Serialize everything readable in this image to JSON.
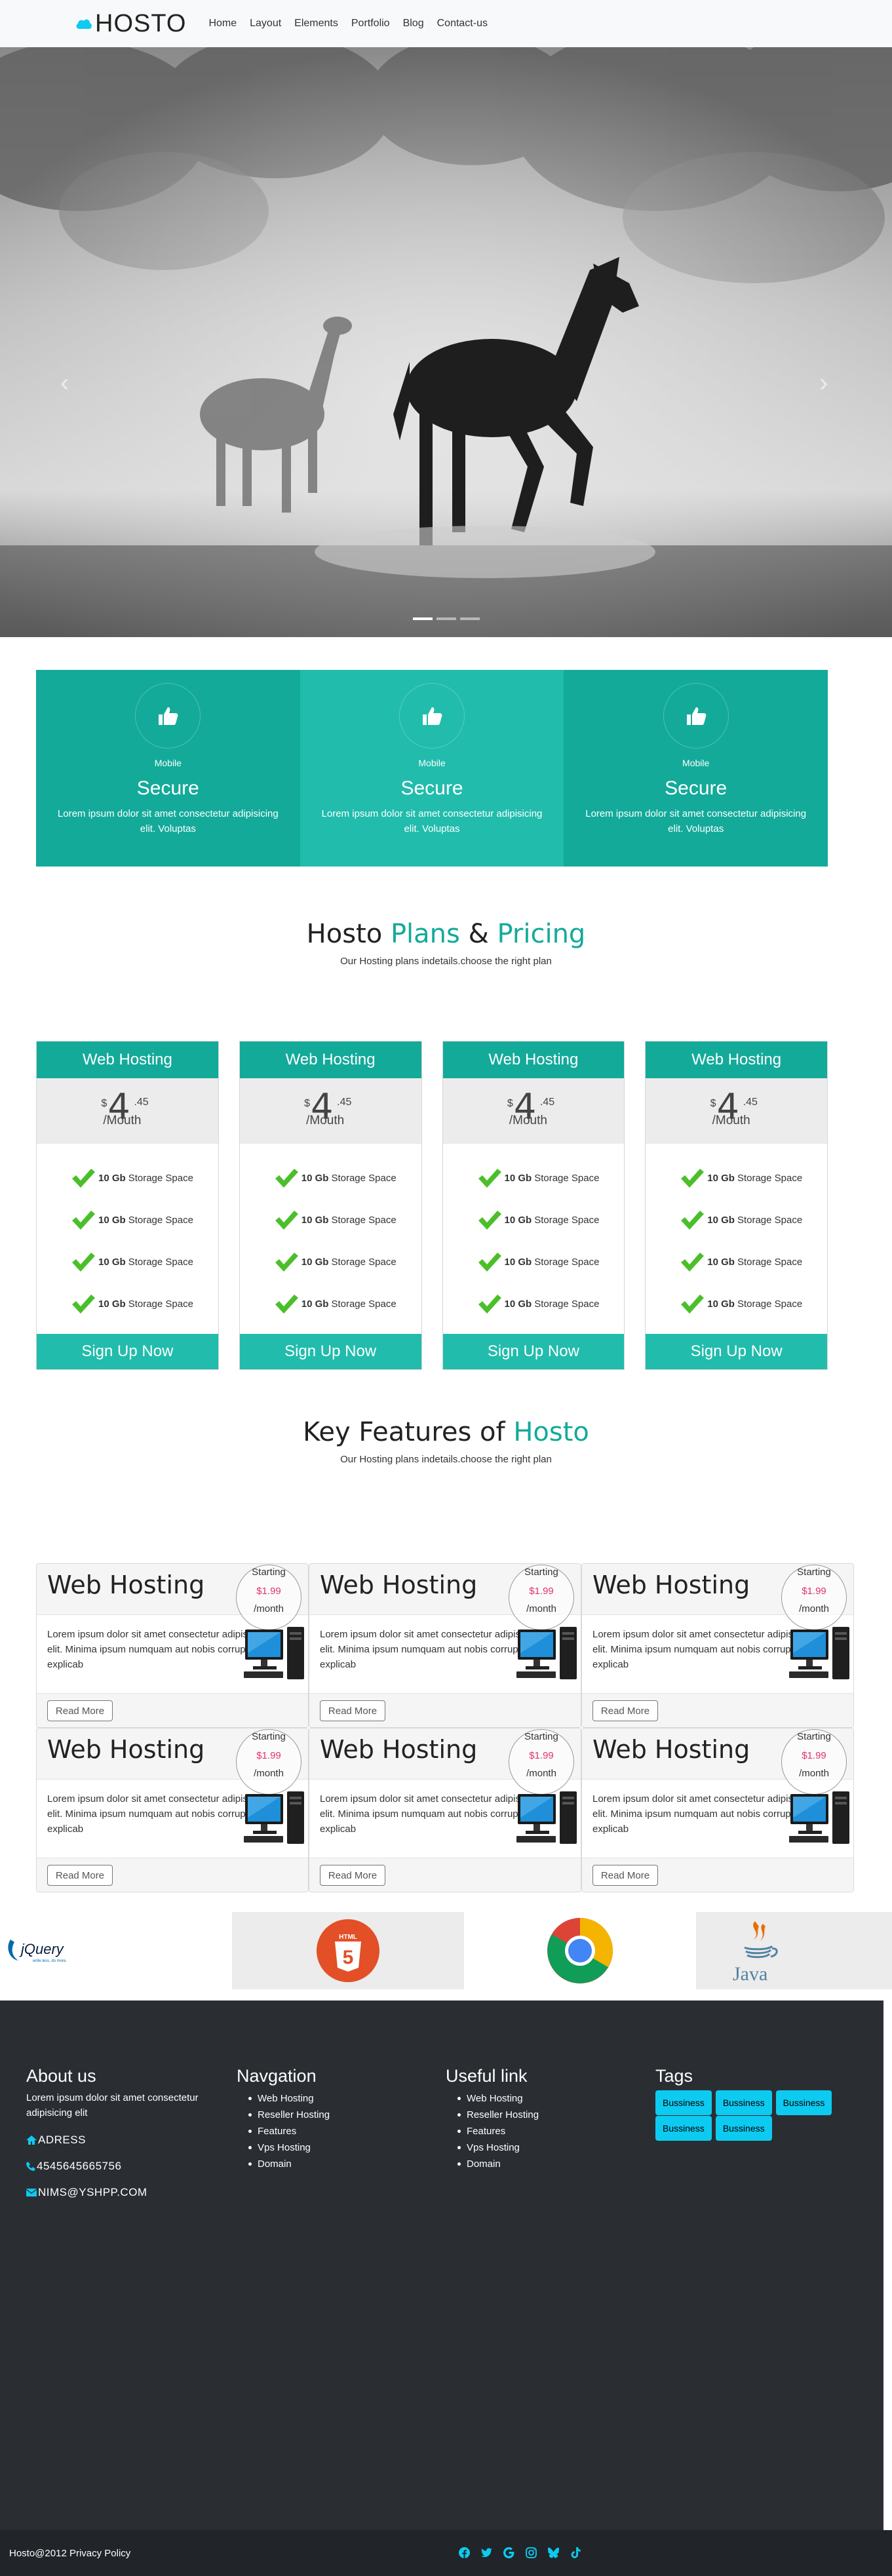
{
  "navbar": {
    "brand": "HOSTO",
    "links": [
      "Home",
      "Layout",
      "Elements",
      "Portfolio",
      "Blog",
      "Contact-us"
    ]
  },
  "carousel": {
    "slide_count": 3,
    "active_slide": 1
  },
  "features": [
    {
      "category": "Mobile",
      "title": "Secure",
      "desc_line1": "Lorem ipsum dolor sit amet consectetur adipisicing",
      "desc_line2": "elit. Voluptas"
    },
    {
      "category": "Mobile",
      "title": "Secure",
      "desc_line1": "Lorem ipsum dolor sit amet consectetur adipisicing",
      "desc_line2": "elit. Voluptas"
    },
    {
      "category": "Mobile",
      "title": "Secure",
      "desc_line1": "Lorem ipsum dolor sit amet consectetur adipisicing",
      "desc_line2": "elit. Voluptas"
    }
  ],
  "plans_section": {
    "title_a": "Hosto ",
    "title_b": "Plans",
    "title_c": " & ",
    "title_d": "Pricing",
    "subtitle": "Our Hosting plans indetails.choose the right plan"
  },
  "plans": [
    {
      "name": "Web Hosting",
      "currency": "$",
      "amount": "4",
      "decimal": ".45",
      "period": "/Mouth",
      "features": [
        {
          "qty": "10 Gb",
          "label": "Storage Space"
        },
        {
          "qty": "10 Gb",
          "label": "Storage Space"
        },
        {
          "qty": "10 Gb",
          "label": "Storage Space"
        },
        {
          "qty": "10 Gb",
          "label": "Storage Space"
        }
      ],
      "cta": "Sign Up Now"
    },
    {
      "name": "Web Hosting",
      "currency": "$",
      "amount": "4",
      "decimal": ".45",
      "period": "/Mouth",
      "features": [
        {
          "qty": "10 Gb",
          "label": "Storage Space"
        },
        {
          "qty": "10 Gb",
          "label": "Storage Space"
        },
        {
          "qty": "10 Gb",
          "label": "Storage Space"
        },
        {
          "qty": "10 Gb",
          "label": "Storage Space"
        }
      ],
      "cta": "Sign Up Now"
    },
    {
      "name": "Web Hosting",
      "currency": "$",
      "amount": "4",
      "decimal": ".45",
      "period": "/Mouth",
      "features": [
        {
          "qty": "10 Gb",
          "label": "Storage Space"
        },
        {
          "qty": "10 Gb",
          "label": "Storage Space"
        },
        {
          "qty": "10 Gb",
          "label": "Storage Space"
        },
        {
          "qty": "10 Gb",
          "label": "Storage Space"
        }
      ],
      "cta": "Sign Up Now"
    },
    {
      "name": "Web Hosting",
      "currency": "$",
      "amount": "4",
      "decimal": ".45",
      "period": "/Mouth",
      "features": [
        {
          "qty": "10 Gb",
          "label": "Storage Space"
        },
        {
          "qty": "10 Gb",
          "label": "Storage Space"
        },
        {
          "qty": "10 Gb",
          "label": "Storage Space"
        },
        {
          "qty": "10 Gb",
          "label": "Storage Space"
        }
      ],
      "cta": "Sign Up Now"
    }
  ],
  "features_section": {
    "title_a": "Key Features of ",
    "title_b": "Hosto",
    "subtitle": "Our Hosting plans indetails.choose the right plan"
  },
  "key_cards": [
    {
      "title": "Web Hosting",
      "badge_top": "Starting",
      "badge_price": "$1.99",
      "badge_per": "/month",
      "text_line1": "Lorem ipsum dolor sit amet consectetur adipisicing",
      "text_line2": "elit. Minima ipsum numquam aut nobis corrupti",
      "text_line3": "explicab",
      "button": "Read More"
    },
    {
      "title": "Web Hosting",
      "badge_top": "Starting",
      "badge_price": "$1.99",
      "badge_per": "/month",
      "text_line1": "Lorem ipsum dolor sit amet consectetur adipisicing",
      "text_line2": "elit. Minima ipsum numquam aut nobis corrupti",
      "text_line3": "explicab",
      "button": "Read More"
    },
    {
      "title": "Web Hosting",
      "badge_top": "Starting",
      "badge_price": "$1.99",
      "badge_per": "/month",
      "text_line1": "Lorem ipsum dolor sit amet consectetur adipisicing",
      "text_line2": "elit. Minima ipsum numquam aut nobis corrupti",
      "text_line3": "explicab",
      "button": "Read More"
    },
    {
      "title": "Web Hosting",
      "badge_top": "Starting",
      "badge_price": "$1.99",
      "badge_per": "/month",
      "text_line1": "Lorem ipsum dolor sit amet consectetur adipisicing",
      "text_line2": "elit. Minima ipsum numquam aut nobis corrupti",
      "text_line3": "explicab",
      "button": "Read More"
    },
    {
      "title": "Web Hosting",
      "badge_top": "Starting",
      "badge_price": "$1.99",
      "badge_per": "/month",
      "text_line1": "Lorem ipsum dolor sit amet consectetur adipisicing",
      "text_line2": "elit. Minima ipsum numquam aut nobis corrupti",
      "text_line3": "explicab",
      "button": "Read More"
    },
    {
      "title": "Web Hosting",
      "badge_top": "Starting",
      "badge_price": "$1.99",
      "badge_per": "/month",
      "text_line1": "Lorem ipsum dolor sit amet consectetur adipisicing",
      "text_line2": "elit. Minima ipsum numquam aut nobis corrupti",
      "text_line3": "explicab",
      "button": "Read More"
    }
  ],
  "logos": {
    "jquery": "jQuery",
    "jquery_tagline": "write less, do more.",
    "html5": "HTML",
    "html5_num": "5",
    "java": "Java"
  },
  "footer": {
    "about_title": "About us",
    "about_text": "Lorem ipsum dolor sit amet consectetur adipisicing elit",
    "address": "ADRESS",
    "phone": "4545645665756",
    "email": "NIMS@YSHPP.COM",
    "nav_title": "Navgation",
    "nav_items": [
      "Web Hosting",
      "Reseller Hosting",
      "Features",
      "Vps Hosting",
      "Domain"
    ],
    "useful_title": "Useful link",
    "useful_items": [
      "Web Hosting",
      "Reseller Hosting",
      "Features",
      "Vps Hosting",
      "Domain"
    ],
    "tags_title": "Tags",
    "tags": [
      "Bussiness",
      "Bussiness",
      "Bussiness",
      "Bussiness",
      "Bussiness"
    ]
  },
  "bottombar": {
    "copyright": "Hosto@2012 Privacy Policy",
    "socials": [
      "facebook-icon",
      "twitter-icon",
      "google-icon",
      "instagram-icon",
      "bluesky-icon",
      "tiktok-icon"
    ]
  },
  "colors": {
    "accent": "#13aa9a",
    "accent_light": "#21bcac",
    "footer_bg": "#2a2e33",
    "tag_bg": "#0dcaf0",
    "social_icon": "#0dcaf0"
  }
}
